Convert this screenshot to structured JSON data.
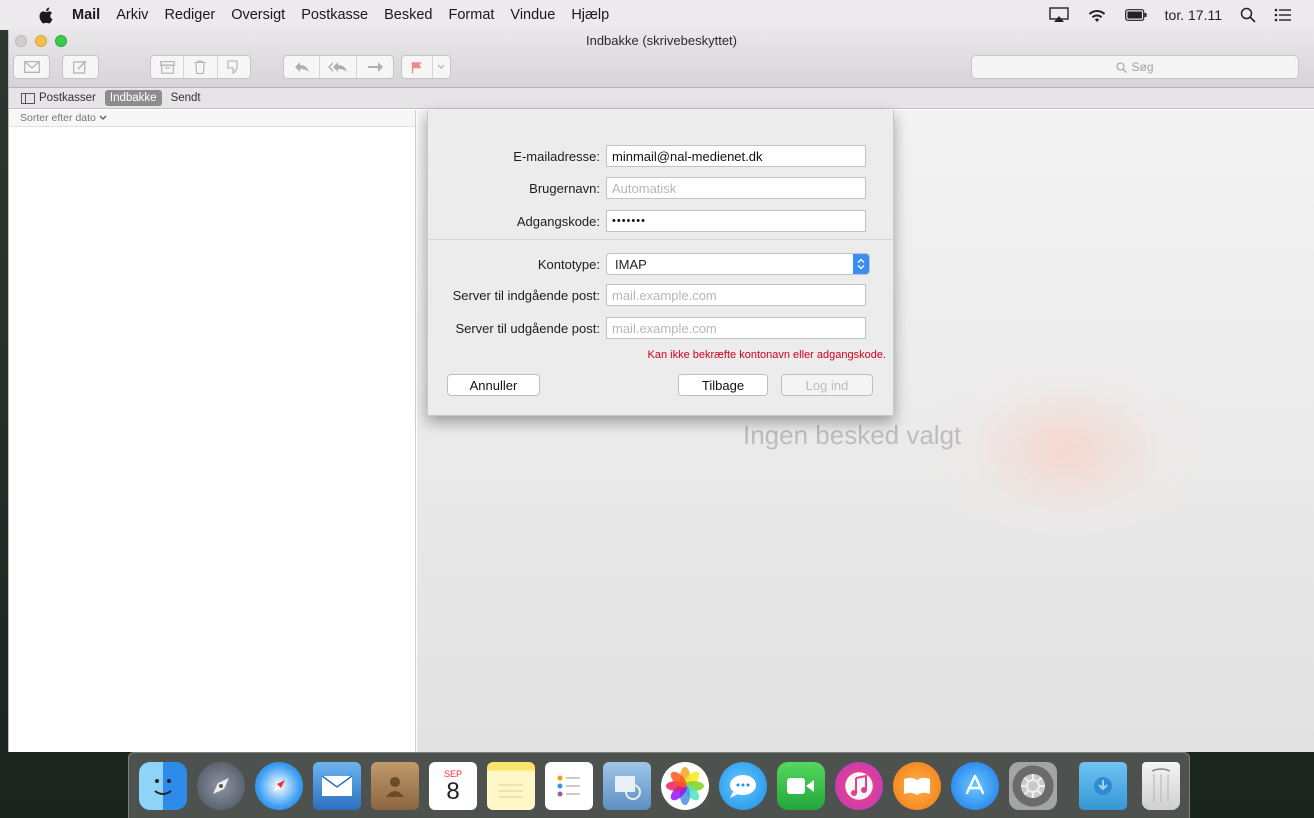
{
  "menubar": {
    "app_name": "Mail",
    "items": [
      "Arkiv",
      "Rediger",
      "Oversigt",
      "Postkasse",
      "Besked",
      "Format",
      "Vindue",
      "Hjælp"
    ],
    "clock": "tor. 17.11"
  },
  "window": {
    "title": "Indbakke (skrivebeskyttet)",
    "search_placeholder": "Søg"
  },
  "favorites": {
    "mailboxes": "Postkasser",
    "inbox": "Indbakke",
    "sent": "Sendt"
  },
  "message_list": {
    "sort_label": "Sorter efter dato"
  },
  "viewer": {
    "empty_text": "Ingen besked valgt"
  },
  "dialog": {
    "email_label": "E-mailadresse:",
    "email_value": "minmail@nal-medienet.dk",
    "username_label": "Brugernavn:",
    "username_placeholder": "Automatisk",
    "password_label": "Adgangskode:",
    "password_mask": "•••••••",
    "account_type_label": "Kontotype:",
    "account_type_value": "IMAP",
    "incoming_label": "Server til indgående post:",
    "incoming_placeholder": "mail.example.com",
    "outgoing_label": "Server til udgående post:",
    "outgoing_placeholder": "mail.example.com",
    "error": "Kan ikke bekræfte kontonavn eller adgangskode.",
    "cancel": "Annuller",
    "back": "Tilbage",
    "login": "Log ind"
  },
  "dock": {
    "calendar_month": "SEP",
    "calendar_day": "8",
    "apps": [
      "finder",
      "launchpad",
      "safari",
      "mail",
      "contacts",
      "calendar",
      "notes",
      "reminders",
      "preview",
      "photos",
      "messages",
      "facetime",
      "itunes",
      "ibooks",
      "app-store",
      "system-preferences",
      "downloads",
      "trash"
    ]
  }
}
